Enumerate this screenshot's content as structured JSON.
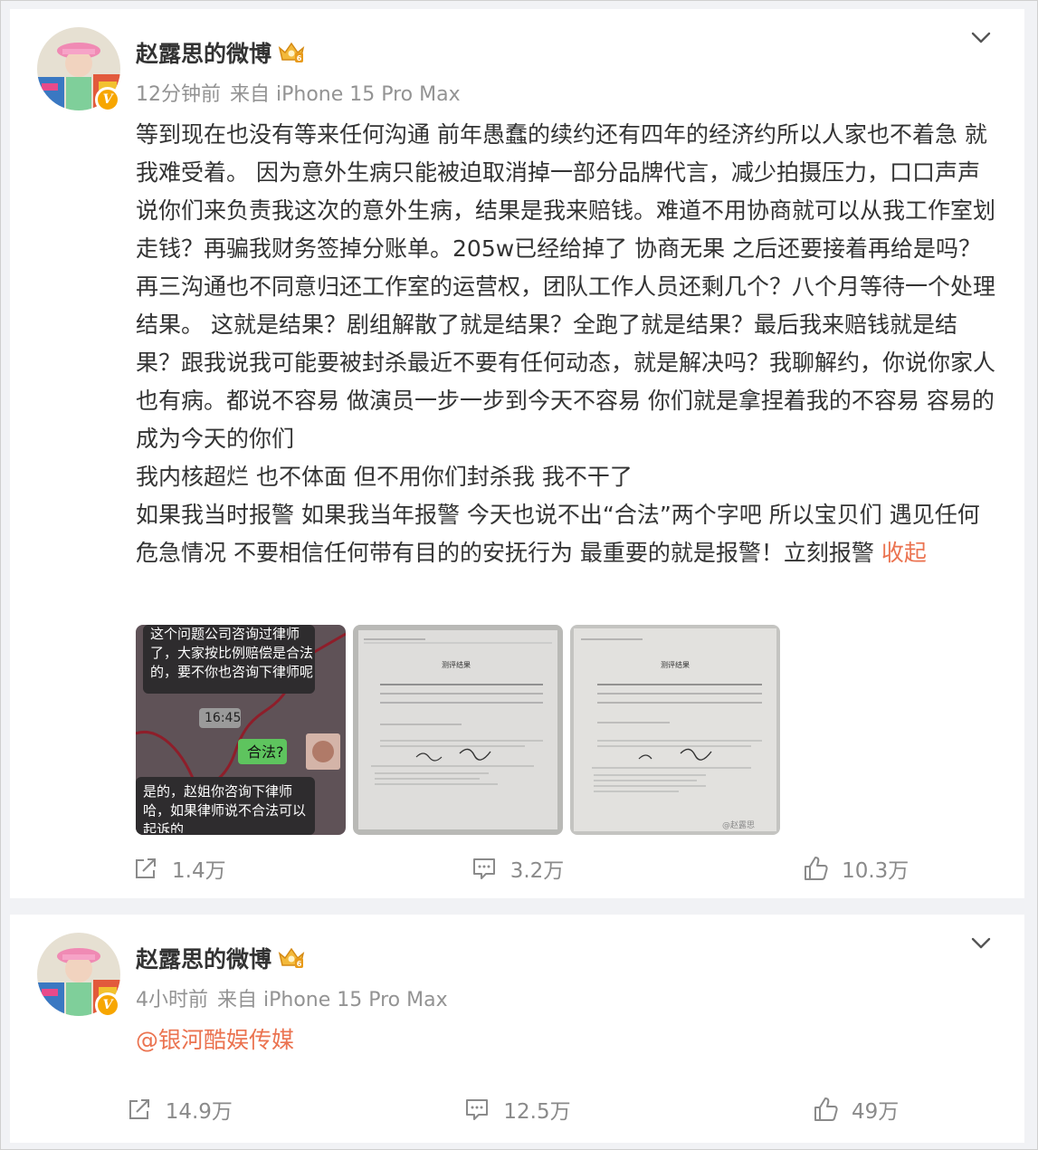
{
  "posts": [
    {
      "author": "赵露思的微博",
      "time": "12分钟前",
      "source": "来自 iPhone 15 Pro Max",
      "paragraphs": [
        "等到现在也没有等来任何沟通 前年愚蠢的续约还有四年的经济约所以人家也不着急 就我难受着。 因为意外生病只能被迫取消掉一部分品牌代言，减少拍摄压力，口口声声说你们来负责我这次的意外生病，结果是我来赔钱。难道不用协商就可以从我工作室划走钱？再骗我财务签掉分账单。205w已经给掉了 协商无果 之后还要接着再给是吗？再三沟通也不同意归还工作室的运营权，团队工作人员还剩几个？八个月等待一个处理结果。 这就是结果？剧组解散了就是结果？全跑了就是结果？最后我来赔钱就是结果？跟我说我可能要被封杀最近不要有任何动态，就是解决吗？我聊解约，你说你家人也有病。都说不容易 做演员一步一步到今天不容易 你们就是拿捏着我的不容易 容易的成为今天的你们",
        "我内核超烂 也不体面 但不用你们封杀我  我不干了",
        "如果我当时报警 如果我当年报警  今天也说不出“合法”两个字吧 所以宝贝们 遇见任何危急情况 不要相信任何带有目的的安抚行为 最重要的就是报警！立刻报警"
      ],
      "collapse_label": "收起",
      "images": {
        "chat": {
          "msg1": "这个问题公司咨询过律师了，大家按比例赔偿是合法的，要不你也咨询下律师呢",
          "time": "16:45",
          "msg2": "合法?",
          "msg3": "是的，赵姐你咨询下律师哈，如果律师说不合法可以起诉的"
        },
        "doc1_title": "测评结果",
        "doc2_title": "测评结果",
        "watermark": "@赵露思"
      },
      "reposts": "1.4万",
      "comments": "3.2万",
      "likes": "10.3万"
    },
    {
      "author": "赵露思的微博",
      "time": "4小时前",
      "source": "来自 iPhone 15 Pro Max",
      "mention": "@银河酷娱传媒",
      "reposts": "14.9万",
      "comments": "12.5万",
      "likes": "49万"
    }
  ],
  "colors": {
    "link": "#eb7350",
    "badge": "#f7a600",
    "meta": "#939393"
  },
  "icons": [
    "avatar",
    "vip-crown-icon",
    "verified-badge-icon",
    "chevron-down-icon",
    "repost-icon",
    "comment-icon",
    "like-icon"
  ]
}
